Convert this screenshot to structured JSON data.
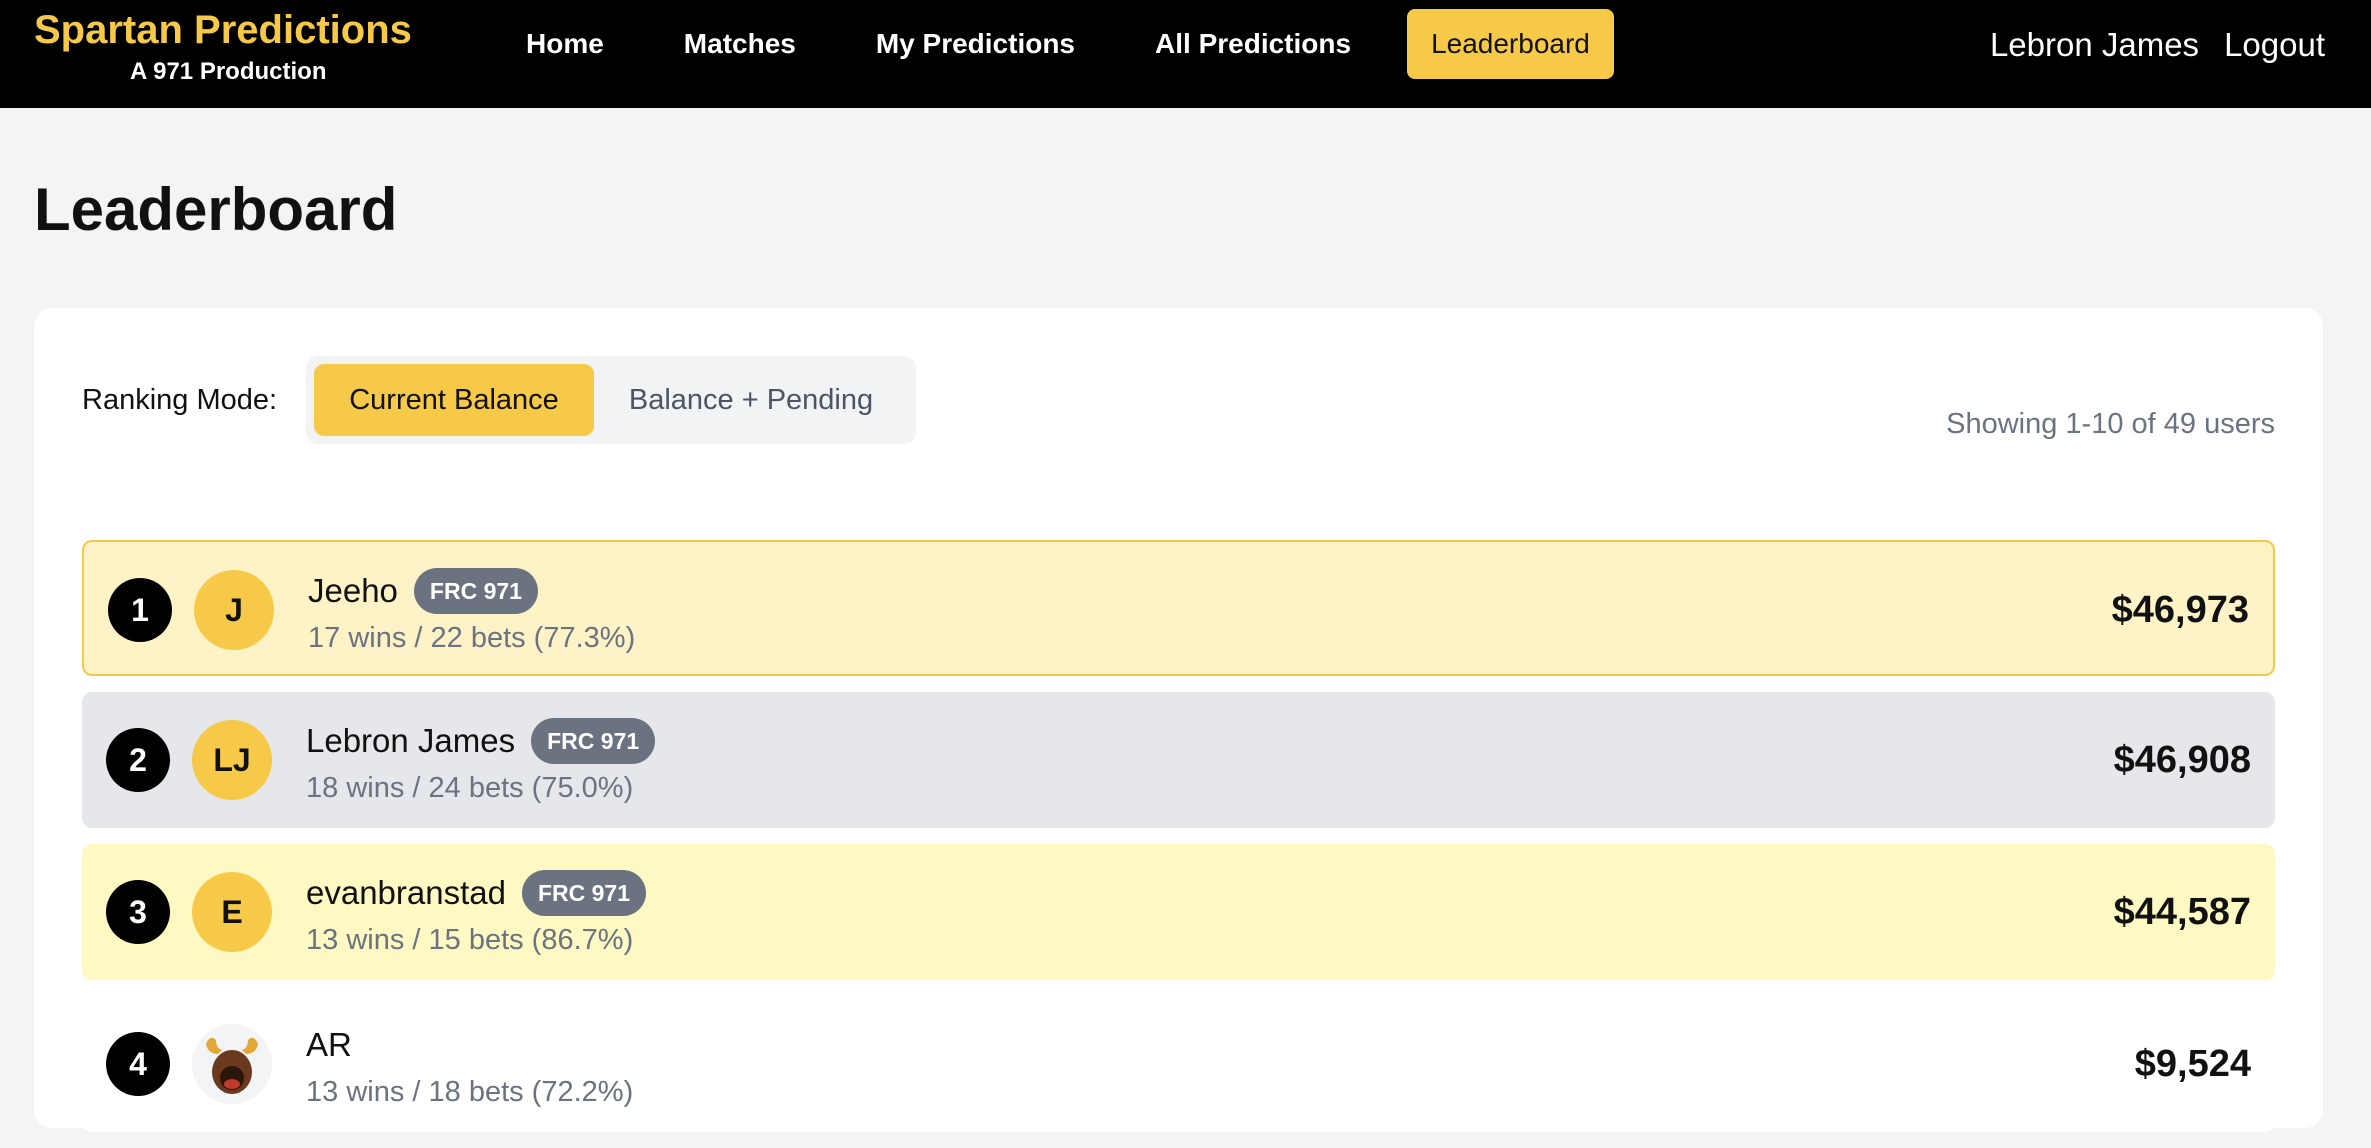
{
  "brand": {
    "title": "Spartan Predictions",
    "subtitle": "A 971 Production",
    "accent": "#f7c948"
  },
  "nav": {
    "items": [
      {
        "label": "Home"
      },
      {
        "label": "Matches"
      },
      {
        "label": "My Predictions"
      },
      {
        "label": "All Predictions"
      },
      {
        "label": "Leaderboard",
        "active": true
      }
    ]
  },
  "user": {
    "name": "Lebron James",
    "logout_label": "Logout"
  },
  "page": {
    "title": "Leaderboard"
  },
  "ranking": {
    "label": "Ranking Mode:",
    "modes": [
      {
        "label": "Current Balance",
        "active": true
      },
      {
        "label": "Balance + Pending",
        "active": false
      }
    ],
    "showing_text": "Showing 1-10 of 49 users"
  },
  "leaderboard": [
    {
      "rank": "1",
      "initials": "J",
      "name": "Jeeho",
      "team": "FRC 971",
      "stats": "17 wins / 22 bets (77.3%)",
      "balance": "$46,973"
    },
    {
      "rank": "2",
      "initials": "LJ",
      "name": "Lebron James",
      "team": "FRC 971",
      "stats": "18 wins / 24 bets (75.0%)",
      "balance": "$46,908"
    },
    {
      "rank": "3",
      "initials": "E",
      "name": "evanbranstad",
      "team": "FRC 971",
      "stats": "13 wins / 15 bets (86.7%)",
      "balance": "$44,587"
    },
    {
      "rank": "4",
      "avatar_icon": "moose-avatar-icon",
      "name": "AR",
      "stats": "13 wins / 18 bets (72.2%)",
      "balance": "$9,524"
    }
  ]
}
